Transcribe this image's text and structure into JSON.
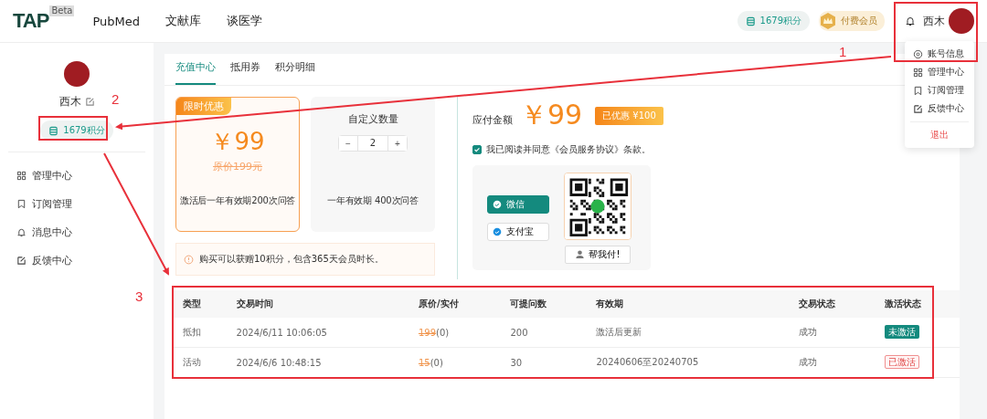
{
  "header": {
    "logo": "TAP",
    "logo_badge": "Beta",
    "nav": [
      {
        "label": "PubMed",
        "selected": false
      },
      {
        "label": "文献库",
        "selected": false
      },
      {
        "label": "谈医学",
        "selected": false
      }
    ],
    "points": "1679积分",
    "member": "付费会员",
    "username": "西木"
  },
  "user_menu": {
    "items": [
      {
        "label": "账号信息",
        "kind": "settings"
      },
      {
        "label": "管理中心",
        "kind": "grid"
      },
      {
        "label": "订阅管理",
        "kind": "bookmark"
      },
      {
        "label": "反馈中心",
        "kind": "edit"
      }
    ],
    "logout": "退出"
  },
  "sidebar": {
    "username": "西木",
    "points": "1679积分",
    "items": [
      {
        "label": "管理中心",
        "kind": "grid"
      },
      {
        "label": "订阅管理",
        "kind": "bookmark"
      },
      {
        "label": "消息中心",
        "kind": "bell"
      },
      {
        "label": "反馈中心",
        "kind": "edit"
      }
    ]
  },
  "tabs": [
    {
      "label": "充值中心",
      "selected": true
    },
    {
      "label": "抵用券",
      "selected": false
    },
    {
      "label": "积分明细",
      "selected": false
    }
  ],
  "packages": [
    {
      "kind": "offer",
      "tag": "限时优惠",
      "price": "￥99",
      "original": "原价199元",
      "desc": "激活后一年有效期200次问答",
      "selected": true
    },
    {
      "kind": "custom",
      "title": "自定义数量",
      "minus": "−",
      "quantity": "2",
      "plus": "+",
      "desc": "一年有效期 400次问答",
      "selected": false
    }
  ],
  "notice": "购买可以获赠10积分，包含365天会员时长。",
  "payment": {
    "label": "应付金额",
    "amount": "￥99",
    "discount": "已优惠 ¥100",
    "agreement": "我已阅读并同意《会员服务协议》条款。",
    "agreed": true,
    "methods": [
      {
        "label": "微信",
        "selected": true
      },
      {
        "label": "支付宝",
        "selected": false
      }
    ],
    "help": "帮我付!"
  },
  "table": {
    "columns": [
      "类型",
      "交易时间",
      "原价/实付",
      "可提问数",
      "有效期",
      "交易状态",
      "激活状态"
    ],
    "rows": [
      {
        "type": "抵扣",
        "time": "2024/6/11 10:06:05",
        "original": "199",
        "paid": "(0)",
        "count": "200",
        "validity": "激活后更新",
        "trade": "成功",
        "status": "未激活",
        "kind": "inactive"
      },
      {
        "type": "活动",
        "time": "2024/6/6 10:48:15",
        "original": "15",
        "paid": "(0)",
        "count": "30",
        "validity": "20240606至20240705",
        "trade": "成功",
        "status": "已激活",
        "kind": "active"
      }
    ]
  },
  "annotations": [
    "1",
    "2",
    "3"
  ]
}
